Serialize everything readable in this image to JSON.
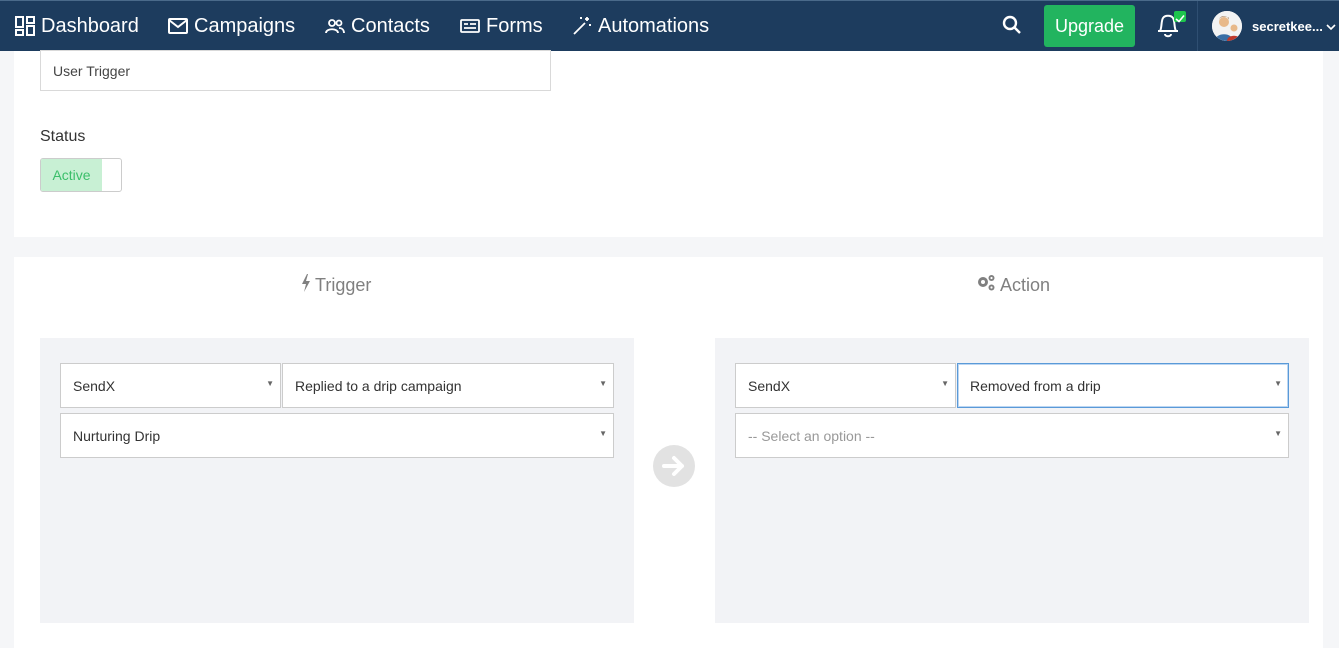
{
  "navbar": {
    "items": [
      {
        "label": "Dashboard",
        "icon": "dashboard-icon"
      },
      {
        "label": "Campaigns",
        "icon": "envelope-icon"
      },
      {
        "label": "Contacts",
        "icon": "users-icon"
      },
      {
        "label": "Forms",
        "icon": "form-icon"
      },
      {
        "label": "Automations",
        "icon": "magic-wand-icon"
      }
    ],
    "upgrade_label": "Upgrade",
    "username": "secretkee..."
  },
  "trigger_form": {
    "name_value": "User Trigger",
    "status_label": "Status",
    "status_value": "Active"
  },
  "rule": {
    "trigger_heading": "Trigger",
    "action_heading": "Action",
    "trigger": {
      "app": "SendX",
      "event": "Replied to a drip campaign",
      "drip": "Nurturing Drip"
    },
    "action": {
      "app": "SendX",
      "event": "Removed from a drip",
      "drip_placeholder": "-- Select an option --"
    }
  },
  "colors": {
    "navbar_bg": "#1d3c5e",
    "upgrade_bg": "#22b45f",
    "active_bg": "#c8f0d4",
    "active_text": "#3bbf6a",
    "panel_bg": "#f2f3f6"
  }
}
